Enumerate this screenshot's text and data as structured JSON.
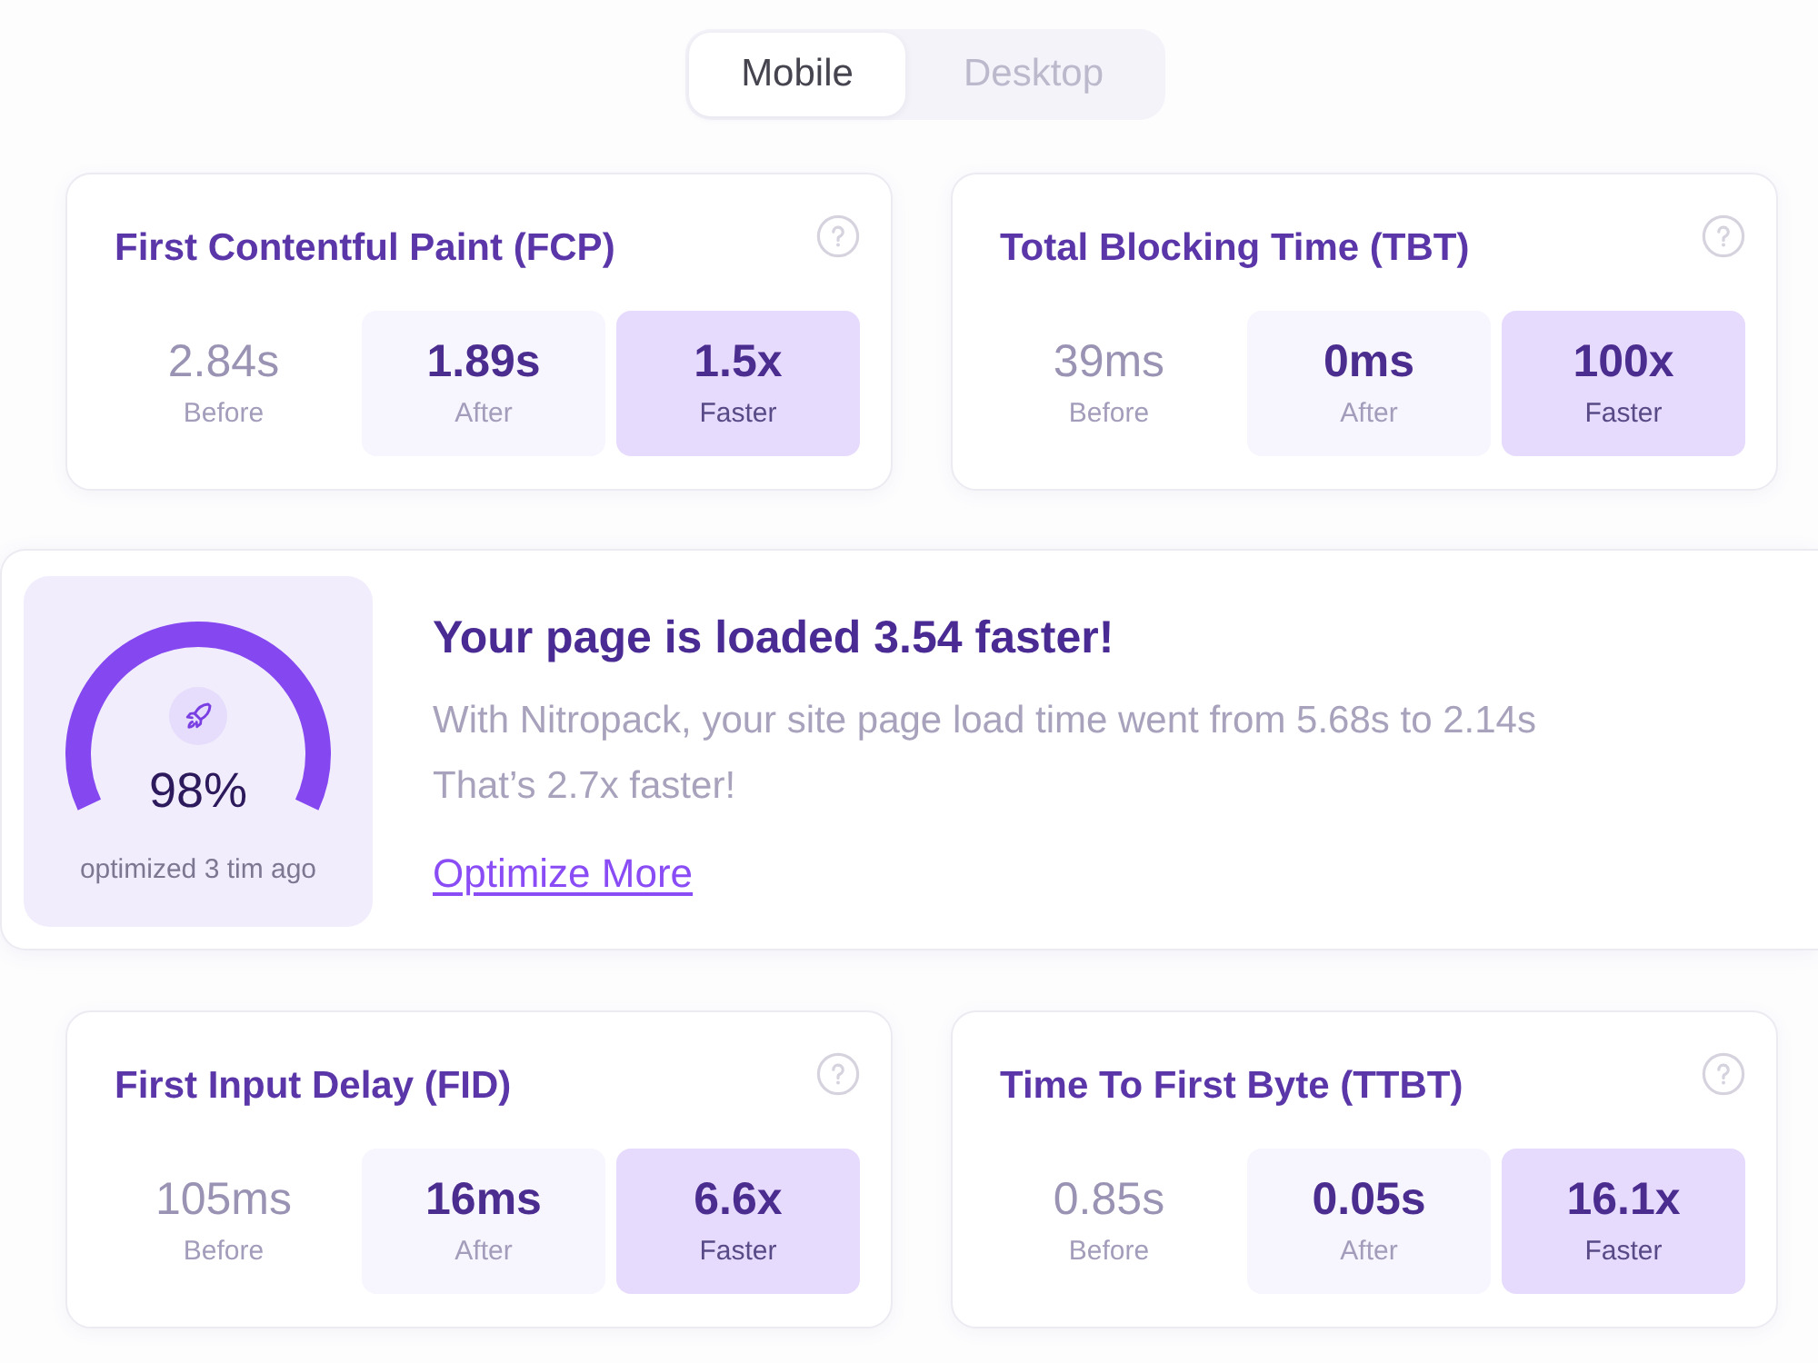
{
  "view_toggle": [
    {
      "label": "Mobile",
      "selected": true
    },
    {
      "label": "Desktop",
      "selected": false
    }
  ],
  "top_metrics": [
    {
      "title": "First Contentful Paint (FCP)",
      "stats": [
        {
          "kind": "before",
          "value": "2.84s",
          "label": "Before"
        },
        {
          "kind": "after",
          "value": "1.89s",
          "label": "After"
        },
        {
          "kind": "gain",
          "value": "1.5x",
          "label": "Faster"
        }
      ]
    },
    {
      "title": "Total Blocking Time (TBT)",
      "stats": [
        {
          "kind": "before",
          "value": "39ms",
          "label": "Before"
        },
        {
          "kind": "after",
          "value": "0ms",
          "label": "After"
        },
        {
          "kind": "gain",
          "value": "100x",
          "label": "Faster"
        }
      ]
    }
  ],
  "summary": {
    "gauge": {
      "reading": "98%",
      "caption": "optimized 3 tim ago"
    },
    "title": "Your page is loaded 3.54 faster!",
    "lines": [
      "With Nitropack, your site page load time went from 5.68s to 2.14s",
      "That’s 2.7x faster!"
    ],
    "link": "Optimize More"
  },
  "bottom_metrics": [
    {
      "title": "First Input Delay (FID)",
      "stats": [
        {
          "kind": "before",
          "value": "105ms",
          "label": "Before"
        },
        {
          "kind": "after",
          "value": "16ms",
          "label": "After"
        },
        {
          "kind": "gain",
          "value": "6.6x",
          "label": "Faster"
        }
      ]
    },
    {
      "title": "Time To First Byte (TTBT)",
      "stats": [
        {
          "kind": "before",
          "value": "0.85s",
          "label": "Before"
        },
        {
          "kind": "after",
          "value": "0.05s",
          "label": "After"
        },
        {
          "kind": "gain",
          "value": "16.1x",
          "label": "Faster"
        }
      ]
    }
  ]
}
